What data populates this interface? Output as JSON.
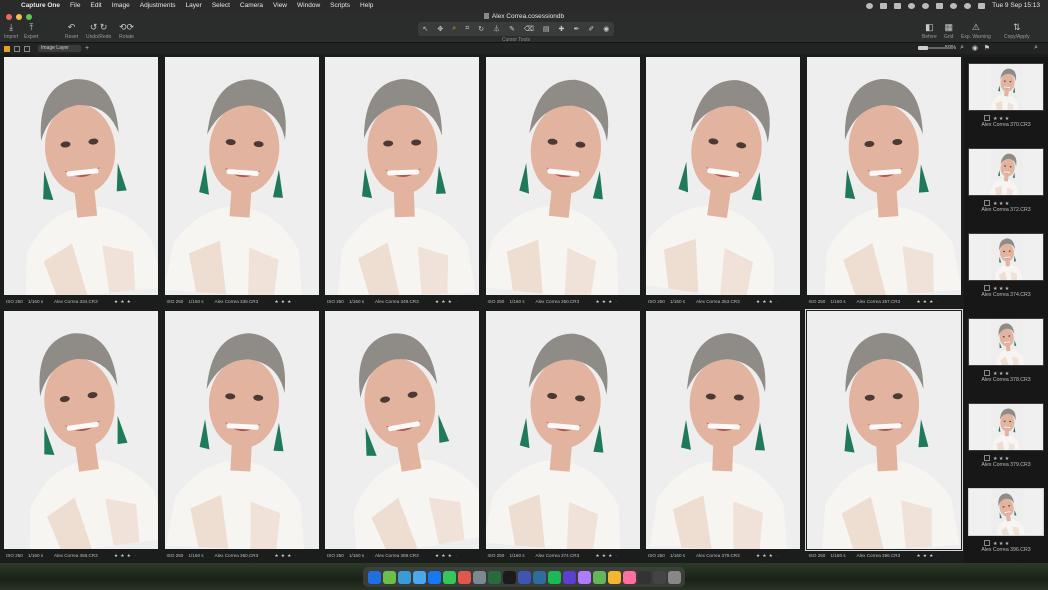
{
  "menubar": {
    "app_name": "Capture One",
    "menus": [
      "File",
      "Edit",
      "Image",
      "Adjustments",
      "Layer",
      "Select",
      "Camera",
      "View",
      "Window",
      "Scripts",
      "Help"
    ],
    "clock": "Tue 9 Sep  15:13"
  },
  "window": {
    "title": "Alex Correa.cosessiondb"
  },
  "toolbar": {
    "import": "Import",
    "export": "Export",
    "reset": "Reset",
    "undo_redo": "Undo/Redo",
    "rotate": "Rotate",
    "cursor_tools_label": "Cursor Tools",
    "before": "Before",
    "grid": "Grid",
    "exp_warning": "Exp. Warning",
    "copy_apply": "Copy/Apply"
  },
  "viewer_bar": {
    "layer": "Image Layer",
    "zoom": "50%"
  },
  "grid_items": [
    {
      "iso": "ISO 250",
      "shutter": "1/160 s",
      "file": "Alex Correa 334.CR3",
      "stars": "★ ★ ★",
      "ext": "·"
    },
    {
      "iso": "ISO 250",
      "shutter": "1/160 s",
      "file": "Alex Correa 338.CR3",
      "stars": "★ ★ ★",
      "ext": "·"
    },
    {
      "iso": "ISO 250",
      "shutter": "1/160 s",
      "file": "Alex Correa 349.CR3",
      "stars": "★ ★ ★",
      "ext": "·"
    },
    {
      "iso": "ISO 250",
      "shutter": "1/160 s",
      "file": "Alex Correa 350.CR3",
      "stars": "★ ★ ★",
      "ext": "·"
    },
    {
      "iso": "ISO 250",
      "shutter": "1/160 s",
      "file": "Alex Correa 353.CR3",
      "stars": "★ ★ ★",
      "ext": "·"
    },
    {
      "iso": "ISO 250",
      "shutter": "1/160 s",
      "file": "Alex Correa 357.CR3",
      "stars": "★ ★ ★",
      "ext": "·"
    },
    {
      "iso": "ISO 250",
      "shutter": "1/160 s",
      "file": "Alex Correa 358.CR3",
      "stars": "★ ★ ★",
      "ext": "·"
    },
    {
      "iso": "ISO 250",
      "shutter": "1/160 s",
      "file": "Alex Correa 360.CR3",
      "stars": "★ ★ ★",
      "ext": "·"
    },
    {
      "iso": "ISO 250",
      "shutter": "1/160 s",
      "file": "Alex Correa 369.CR3",
      "stars": "★ ★ ★",
      "ext": "·"
    },
    {
      "iso": "ISO 250",
      "shutter": "1/160 s",
      "file": "Alex Correa 374.CR3",
      "stars": "★ ★ ★",
      "ext": "·"
    },
    {
      "iso": "ISO 250",
      "shutter": "1/160 s",
      "file": "Alex Correa 379.CR3",
      "stars": "★ ★ ★",
      "ext": "·"
    },
    {
      "iso": "ISO 250",
      "shutter": "1/160 s",
      "file": "Alex Correa 396.CR3",
      "stars": "★ ★ ★",
      "ext": "·"
    }
  ],
  "filmstrip": [
    {
      "file": "Alex Correa 370.CR3",
      "stars": "★ ★ ★"
    },
    {
      "file": "Alex Correa 372.CR3",
      "stars": "★ ★ ★"
    },
    {
      "file": "Alex Correa 374.CR3",
      "stars": "★ ★ ★"
    },
    {
      "file": "Alex Correa 378.CR3",
      "stars": "★ ★ ★"
    },
    {
      "file": "Alex Correa 379.CR3",
      "stars": "★ ★ ★"
    },
    {
      "file": "Alex Correa 396.CR3",
      "stars": "★ ★ ★"
    }
  ],
  "colors": {
    "accent": "#e3a321",
    "photo_bg": "#eeeeee",
    "blouse": "#f7f5f2",
    "hair": "#8f8b86",
    "skin": "#e2b49f",
    "earring": "#1f7a5a"
  }
}
